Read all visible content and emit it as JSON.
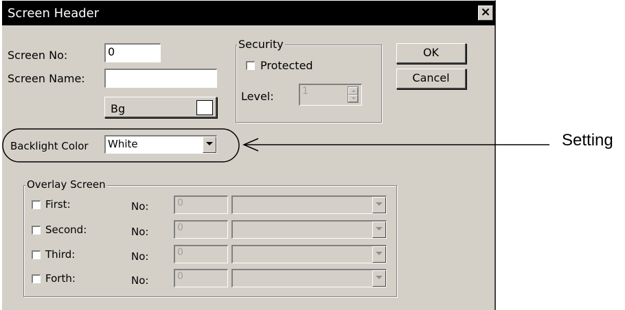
{
  "window": {
    "title": "Screen Header",
    "close_symbol": "×"
  },
  "fields": {
    "screen_no_label": "Screen No:",
    "screen_no_value": "0",
    "screen_name_label": "Screen Name:",
    "screen_name_value": "",
    "bg_label": "Bg",
    "bg_color": "#ffffff",
    "backlight_label": "Backlight Color",
    "backlight_value": "White"
  },
  "security": {
    "legend": "Security",
    "protected_label": "Protected",
    "protected_checked": false,
    "level_label": "Level:",
    "level_value": "1"
  },
  "buttons": {
    "ok": "OK",
    "cancel": "Cancel"
  },
  "overlay": {
    "legend": "Overlay Screen",
    "rows": [
      {
        "label": "First:",
        "no_label": "No:",
        "no_value": "0",
        "checked": false
      },
      {
        "label": "Second:",
        "no_label": "No:",
        "no_value": "0",
        "checked": false
      },
      {
        "label": "Third:",
        "no_label": "No:",
        "no_value": "0",
        "checked": false
      },
      {
        "label": "Forth:",
        "no_label": "No:",
        "no_value": "0",
        "checked": false
      }
    ]
  },
  "annotation": {
    "label": "Setting"
  }
}
